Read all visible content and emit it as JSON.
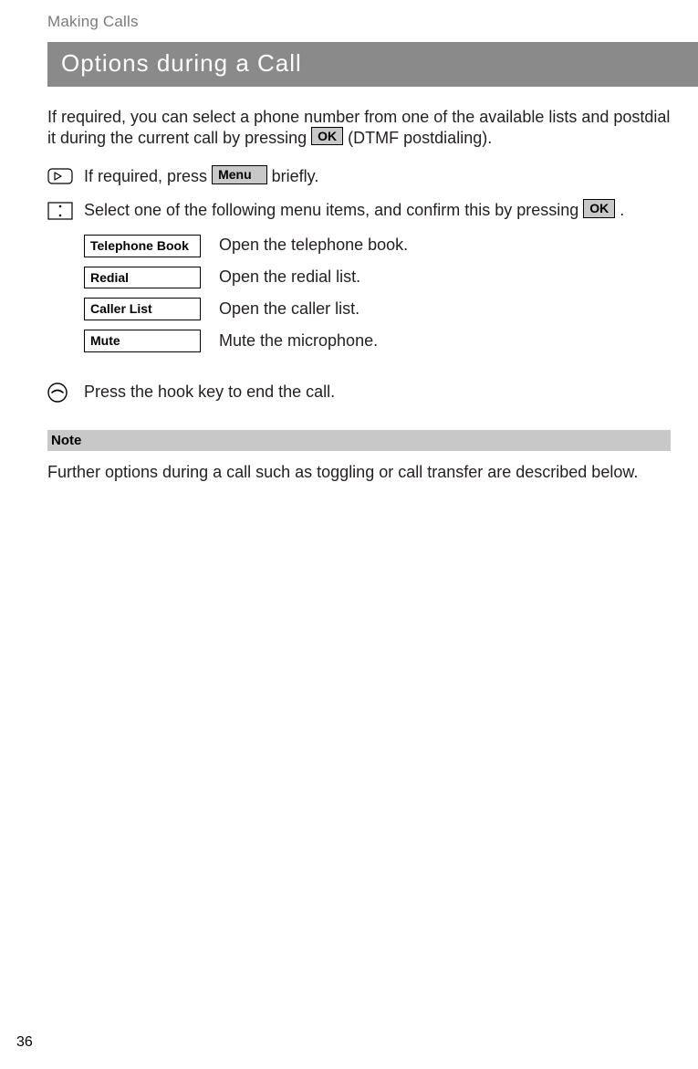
{
  "header": "Making Calls",
  "section_title": "Options during a Call",
  "intro_before": "If required, you can select a phone number from one of the available lists and postdial it during the current call by pressing ",
  "intro_key": "OK",
  "intro_after": " (DTMF postdialing).",
  "step1": {
    "before": "If required, press ",
    "key": "Menu",
    "after": " briefly."
  },
  "step2": {
    "before": "Select one of the following menu items, and confirm this by pressing ",
    "key": "OK",
    "after": " ."
  },
  "menu": [
    {
      "label": "Telephone Book",
      "desc": "Open the telephone book."
    },
    {
      "label": "Redial",
      "desc": "Open the redial list."
    },
    {
      "label": "Caller List",
      "desc": "Open the caller list."
    },
    {
      "label": "Mute",
      "desc": "Mute the microphone."
    }
  ],
  "hook_text": "Press the hook key to end the call.",
  "note_label": "Note",
  "note_text": "Further options during a call such as toggling or call transfer are described below.",
  "page_number": "36"
}
